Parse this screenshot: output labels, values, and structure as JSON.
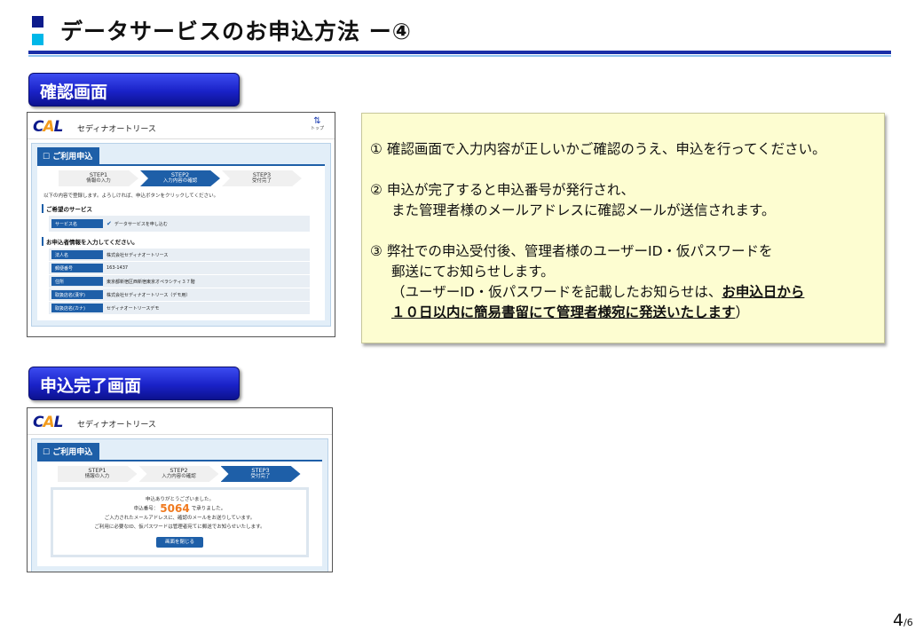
{
  "header": {
    "title": "データサービスのお申込方法 ー④"
  },
  "sections": {
    "confirm_label": "確認画面",
    "complete_label": "申込完了画面"
  },
  "app": {
    "logo": "CAL",
    "name": "セディナオートリース",
    "top_label": "トップ",
    "tab": "ご利用申込",
    "steps": [
      {
        "num": "STEP1",
        "label": "情報の入力"
      },
      {
        "num": "STEP2",
        "label": "入力内容の確認"
      },
      {
        "num": "STEP3",
        "label": "受付完了"
      }
    ]
  },
  "confirm_screen": {
    "active_step": 2,
    "intro": "以下の内容で登録します。よろしければ、申込ボタンをクリックしてください。",
    "service_heading": "ご希望のサービス",
    "service_key": "サービス名",
    "service_value": "データサービスを申し込む",
    "info_heading": "お申込者情報を入力してください。",
    "rows": [
      {
        "k": "法人名",
        "v": "株式会社セディナオートリース"
      },
      {
        "k": "郵便番号",
        "v": "163-1437"
      },
      {
        "k": "住所",
        "v": "東京都新宿区西新宿東京オペラシティ３７階"
      },
      {
        "k": "取扱店名(漢字)",
        "v": "株式会社セディナオートリース（デモ用）"
      },
      {
        "k": "取扱店名(カナ)",
        "v": "セディナオートリースデモ"
      }
    ]
  },
  "complete_screen": {
    "active_step": 3,
    "thanks": "申込ありがとうございました。",
    "num_prefix": "申込番号：",
    "num_value": "5064",
    "num_suffix": "で承りました。",
    "mail_msg": "ご入力されたメールアドレスに、確認のメールをお送りしています。",
    "pw_msg": "ご利用に必要なID、仮パスワードは管理者宛てに郵送でお知らせいたします。",
    "close_button": "画面を閉じる"
  },
  "note": {
    "l1": "① 確認画面で入力内容が正しいかご確認のうえ、申込を行ってください。",
    "l2a": "② 申込が完了すると申込番号が発行され、",
    "l2b": "また管理者様のメールアドレスに確認メールが送信されます。",
    "l3a": "③ 弊社での申込受付後、管理者様のユーザーID・仮パスワードを",
    "l3b": "郵送にてお知らせします。",
    "l3c_pre": "（ユーザーID・仮パスワードを記載したお知らせは、",
    "l3c_ul": "お申込日から",
    "l3d_ul": "１０日以内に簡易書留にて管理者様宛に発送いたします",
    "l3d_post": "）"
  },
  "page": {
    "current": "4",
    "total": "/6"
  }
}
